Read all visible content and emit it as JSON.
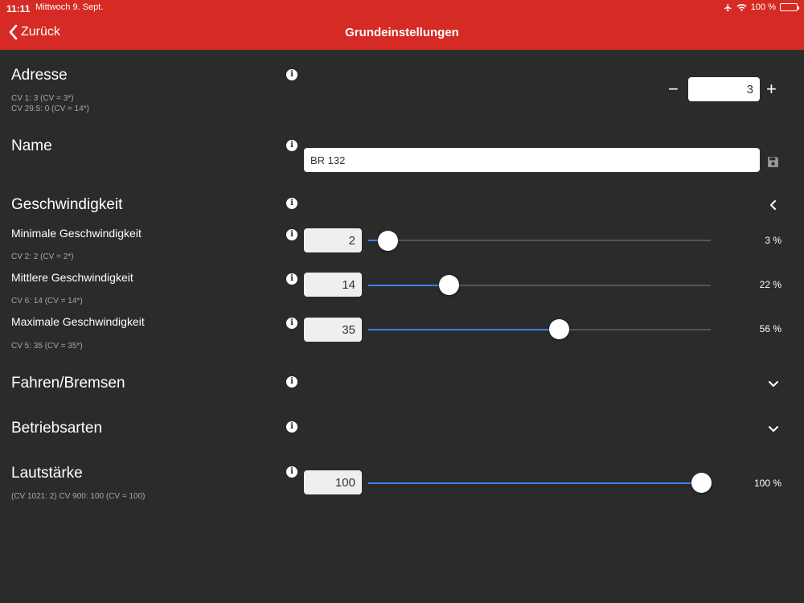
{
  "status": {
    "time": "11:11",
    "date": "Mittwoch 9. Sept.",
    "battery": "100 %"
  },
  "nav": {
    "back": "Zurück",
    "title": "Grundeinstellungen"
  },
  "adresse": {
    "label": "Adresse",
    "cv1": "CV 1: 3 (CV = 3*)",
    "cv2": "CV 29.5: 0 (CV = 14*)",
    "value": "3",
    "minus": "−",
    "plus": "+"
  },
  "name": {
    "label": "Name",
    "value": "BR 132"
  },
  "geschwindigkeit": {
    "label": "Geschwindigkeit",
    "min": {
      "label": "Minimale Geschwindigkeit",
      "cv": "CV 2: 2 (CV = 2*)",
      "value": "2",
      "percent": "3 %",
      "level": 0.03
    },
    "mid": {
      "label": "Mittlere Geschwindigkeit",
      "cv": "CV 6: 14 (CV = 14*)",
      "value": "14",
      "percent": "22 %",
      "level": 0.22
    },
    "max": {
      "label": "Maximale Geschwindigkeit",
      "cv": "CV 5: 35 (CV = 35*)",
      "value": "35",
      "percent": "56 %",
      "level": 0.56
    }
  },
  "fahren": {
    "label": "Fahren/Bremsen"
  },
  "betrieb": {
    "label": "Betriebsarten"
  },
  "laut": {
    "label": "Lautstärke",
    "cv": "(CV 1021: 2) CV 900: 100 (CV = 100)",
    "value": "100",
    "percent": "100 %",
    "level": 1.0
  },
  "colors": {
    "header": "#d62b25",
    "background": "#2b2b2b",
    "accent": "#3c82f0"
  },
  "icons": {
    "info": "info-icon",
    "save": "save-icon",
    "back": "chevron-left-icon",
    "collapse": "chevron-left-icon",
    "expand": "chevron-down-icon"
  }
}
